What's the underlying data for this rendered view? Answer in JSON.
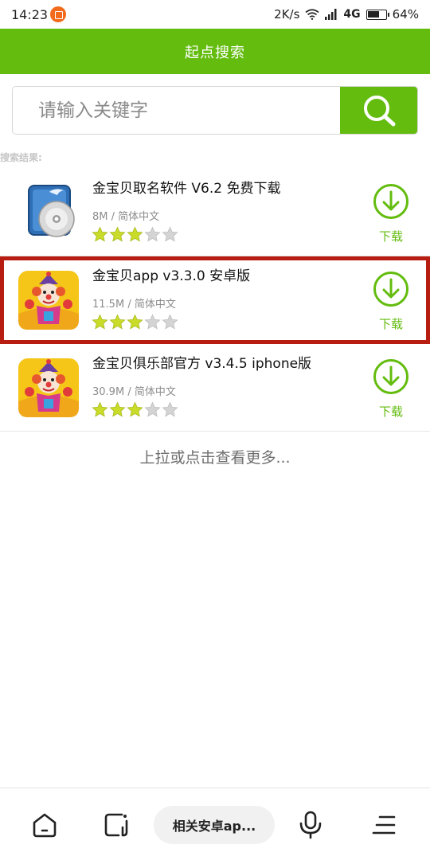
{
  "status_bar": {
    "time": "14:23",
    "network_speed": "2K/s",
    "network_type": "4G",
    "battery": "64%"
  },
  "header": {
    "title": "起点搜索"
  },
  "search": {
    "placeholder": "请输入关键字",
    "value": ""
  },
  "results_label": "搜索结果:",
  "results": [
    {
      "name": "金宝贝取名软件 V6.2 免费下载",
      "size": "8M",
      "separator": "/",
      "language": "简体中文",
      "rating": 3,
      "rating_max": 5,
      "icon": "cd-disc-app-icon",
      "download_label": "下载"
    },
    {
      "name": "金宝贝app v3.3.0 安卓版",
      "size": "11.5M",
      "separator": "/",
      "language": "简体中文",
      "rating": 3,
      "rating_max": 5,
      "icon": "clown-app-icon",
      "download_label": "下载",
      "highlighted": true
    },
    {
      "name": "金宝贝俱乐部官方 v3.4.5 iphone版",
      "size": "30.9M",
      "separator": "/",
      "language": "简体中文",
      "rating": 3,
      "rating_max": 5,
      "icon": "clown-app-icon",
      "download_label": "下载"
    }
  ],
  "load_more": "上拉或点击查看更多...",
  "bottom_bar": {
    "pill_label": "相关安卓ap...",
    "icons": [
      "home-icon",
      "tabs-icon",
      "microphone-icon",
      "menu-icon"
    ]
  },
  "colors": {
    "brand_green": "#63bc0e",
    "highlight_red": "#b81d12",
    "star_yellow": "#c9dc2a",
    "star_gray": "#d4d4d4"
  }
}
